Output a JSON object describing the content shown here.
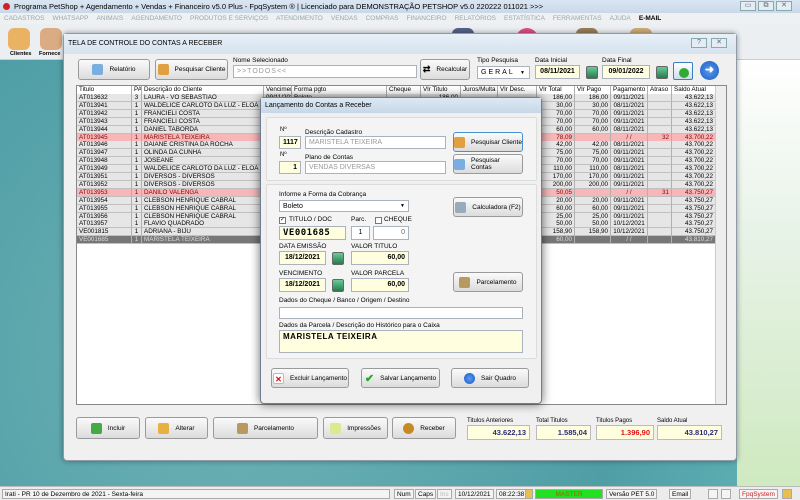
{
  "app": {
    "title": "Programa PetShop + Agendamento + Vendas + Financeiro v5.0 Plus - FpqSystem ® | Licenciado para  DEMONSTRAÇÃO PETSHOP v5.0 220222 011021 >>>",
    "min": "▭",
    "max": "⧉",
    "close": "✕"
  },
  "menu": [
    "CADASTROS",
    "WHATSAPP",
    "ANIMAIS",
    "AGENDAMENTO",
    "PRODUTOS E SERVIÇOS",
    "ATENDIMENTO",
    "VENDAS",
    "COMPRAS",
    "FINANCEIRO",
    "RELATÓRIOS",
    "ESTATÍSTICA",
    "FERRAMENTAS",
    "AJUDA",
    "E-MAIL"
  ],
  "toolbar": {
    "clientes": "Clientes",
    "fornece": "Fornece"
  },
  "main": {
    "title": "TELA DE CONTROLE DO CONTAS A RECEBER",
    "help": "?",
    "close": "✕",
    "relatorio": "Relatório",
    "pesquisar_cliente": "Pesquisar Cliente",
    "nome_label": "Nome Selecionado",
    "nome_value": ">>TODOS<<",
    "recalcular": "Recalcular",
    "tipo_label": "Tipo  Pesquisa",
    "tipo_value": "GERAL",
    "data_inicial_label": "Data Inicial",
    "data_inicial": "08/11/2021",
    "data_final_label": "Data Final",
    "data_final": "09/01/2022"
  },
  "table": {
    "columns": [
      "Titulo",
      "PA",
      "Descrição do Cliente",
      "Vencimento",
      "Forma pgto",
      "Cheque",
      "Vlr Titulo",
      "Juros/Multa",
      "Vlr Desc.",
      "Vlr Total",
      "Vlr Pago",
      "Pagamento",
      "Atraso",
      "Saldo Atual"
    ],
    "rows": [
      {
        "titulo": "AT013632",
        "pa": "3",
        "cliente": "LAURA - VÓ SEBASTIÃO",
        "venc": "09/11/2021",
        "forma": "Boleto",
        "vlr_titulo": "186,00",
        "total": "186,00",
        "pago": "186,00",
        "pagamento": "09/11/2021",
        "atraso": "",
        "saldo": "43.622,13",
        "state": "normal"
      },
      {
        "titulo": "AT013941",
        "pa": "1",
        "cliente": "WALDELICE CARLOTO DA LUZ - ELOÁ",
        "venc": "",
        "forma": "",
        "vlr_titulo": "",
        "total": "30,00",
        "pago": "30,00",
        "pagamento": "08/11/2021",
        "atraso": "",
        "saldo": "43.622,13",
        "state": "normal"
      },
      {
        "titulo": "AT013942",
        "pa": "1",
        "cliente": "FRANCIELI COSTA",
        "venc": "",
        "forma": "",
        "vlr_titulo": "",
        "total": "70,00",
        "pago": "70,00",
        "pagamento": "09/11/2021",
        "atraso": "",
        "saldo": "43.622,13",
        "state": "normal"
      },
      {
        "titulo": "AT013943",
        "pa": "1",
        "cliente": "FRANCIELI COSTA",
        "venc": "",
        "forma": "",
        "vlr_titulo": "",
        "total": "70,00",
        "pago": "70,00",
        "pagamento": "09/11/2021",
        "atraso": "",
        "saldo": "43.622,13",
        "state": "normal"
      },
      {
        "titulo": "AT013944",
        "pa": "1",
        "cliente": "DANIEL TABORDA",
        "venc": "",
        "forma": "",
        "vlr_titulo": "",
        "total": "60,00",
        "pago": "60,00",
        "pagamento": "08/11/2021",
        "atraso": "",
        "saldo": "43.622,13",
        "state": "normal"
      },
      {
        "titulo": "AT013945",
        "pa": "1",
        "cliente": "MARISTELA TEIXEIRA",
        "venc": "",
        "forma": "",
        "vlr_titulo": "",
        "total": "78,09",
        "pago": "",
        "pagamento": "/ /",
        "atraso": "32",
        "saldo": "43.700,22",
        "state": "overdue"
      },
      {
        "titulo": "AT013946",
        "pa": "1",
        "cliente": "DAIANE CRISTINA DA ROCHA",
        "venc": "",
        "forma": "",
        "vlr_titulo": "",
        "total": "42,00",
        "pago": "42,00",
        "pagamento": "08/11/2021",
        "atraso": "",
        "saldo": "43.700,22",
        "state": "normal"
      },
      {
        "titulo": "AT013947",
        "pa": "1",
        "cliente": "OLINDA DA CUNHA",
        "venc": "",
        "forma": "",
        "vlr_titulo": "",
        "total": "75,00",
        "pago": "75,00",
        "pagamento": "09/11/2021",
        "atraso": "",
        "saldo": "43.700,22",
        "state": "normal"
      },
      {
        "titulo": "AT013948",
        "pa": "1",
        "cliente": "JOSEANE",
        "venc": "",
        "forma": "",
        "vlr_titulo": "",
        "total": "70,00",
        "pago": "70,00",
        "pagamento": "09/11/2021",
        "atraso": "",
        "saldo": "43.700,22",
        "state": "normal"
      },
      {
        "titulo": "AT013949",
        "pa": "1",
        "cliente": "WALDELICE CARLOTO DA LUZ - ELOÁ",
        "venc": "",
        "forma": "",
        "vlr_titulo": "",
        "total": "110,00",
        "pago": "110,00",
        "pagamento": "08/11/2021",
        "atraso": "",
        "saldo": "43.700,22",
        "state": "normal"
      },
      {
        "titulo": "AT013951",
        "pa": "1",
        "cliente": "DIVERSOS - DIVERSOS",
        "venc": "",
        "forma": "",
        "vlr_titulo": "",
        "total": "170,00",
        "pago": "170,00",
        "pagamento": "09/11/2021",
        "atraso": "",
        "saldo": "43.700,22",
        "state": "normal"
      },
      {
        "titulo": "AT013952",
        "pa": "1",
        "cliente": "DIVERSOS - DIVERSOS",
        "venc": "",
        "forma": "",
        "vlr_titulo": "",
        "total": "200,00",
        "pago": "200,00",
        "pagamento": "09/11/2021",
        "atraso": "",
        "saldo": "43.700,22",
        "state": "normal"
      },
      {
        "titulo": "AT013953",
        "pa": "1",
        "cliente": "DANILO VALENGA",
        "venc": "",
        "forma": "",
        "vlr_titulo": "",
        "total": "50,05",
        "pago": "",
        "pagamento": "/ /",
        "atraso": "31",
        "saldo": "43.750,27",
        "state": "overdue"
      },
      {
        "titulo": "AT013954",
        "pa": "1",
        "cliente": "CLEBSON HENRIQUE CABRAL",
        "venc": "",
        "forma": "",
        "vlr_titulo": "",
        "total": "20,00",
        "pago": "20,00",
        "pagamento": "09/11/2021",
        "atraso": "",
        "saldo": "43.750,27",
        "state": "normal"
      },
      {
        "titulo": "AT013955",
        "pa": "1",
        "cliente": "CLEBSON HENRIQUE CABRAL",
        "venc": "",
        "forma": "",
        "vlr_titulo": "",
        "total": "60,00",
        "pago": "60,00",
        "pagamento": "09/11/2021",
        "atraso": "",
        "saldo": "43.750,27",
        "state": "normal"
      },
      {
        "titulo": "AT013956",
        "pa": "1",
        "cliente": "CLEBSON HENRIQUE CABRAL",
        "venc": "",
        "forma": "",
        "vlr_titulo": "",
        "total": "25,00",
        "pago": "25,00",
        "pagamento": "09/11/2021",
        "atraso": "",
        "saldo": "43.750,27",
        "state": "normal"
      },
      {
        "titulo": "AT013957",
        "pa": "1",
        "cliente": "FLAVIO QUADRADO",
        "venc": "",
        "forma": "",
        "vlr_titulo": "",
        "total": "50,00",
        "pago": "50,00",
        "pagamento": "10/12/2021",
        "atraso": "",
        "saldo": "43.750,27",
        "state": "normal"
      },
      {
        "titulo": "VE001815",
        "pa": "1",
        "cliente": "ADRIANA  - BIJU",
        "venc": "",
        "forma": "",
        "vlr_titulo": "",
        "total": "158,90",
        "pago": "158,90",
        "pagamento": "10/12/2021",
        "atraso": "",
        "saldo": "43.750,27",
        "state": "normal"
      },
      {
        "titulo": "VE001685",
        "pa": "1",
        "cliente": "MARISTELA TEIXEIRA",
        "venc": "",
        "forma": "",
        "vlr_titulo": "",
        "total": "60,00",
        "pago": "",
        "pagamento": "/ /",
        "atraso": "",
        "saldo": "43.810,27",
        "state": "selected"
      }
    ]
  },
  "dialog": {
    "title": "Lançamento do Contas a Receber",
    "no_label": "Nº",
    "cadastro_label": "Descrição Cadastro",
    "cadastro_no": "1117",
    "cadastro_nome": "MARISTELA TEIXEIRA",
    "no2_label": "Nº",
    "plano_label": "Plano de Contas",
    "plano_no": "1",
    "plano_nome": "VENDAS DIVERSAS",
    "pesquisar_cliente": "Pesquisar Cliente",
    "pesquisar_contas": "Pesquisar Contas",
    "forma_label": "Informe a Forma da Cobrança",
    "forma_value": "Boleto",
    "calculadora": "Calculadora (F2)",
    "titulo_doc_label": "TITULO / DOC",
    "titulo_doc_checked": true,
    "parc_label": "Parc.",
    "cheque_label": "CHEQUE",
    "cheque_checked": false,
    "titulo_doc": "VE001685",
    "parc": "1",
    "cheque": "0",
    "emissao_label": "DATA EMISSÃO",
    "emissao": "18/12/2021",
    "valor_titulo_label": "VALOR TITULO",
    "valor_titulo": "60,00",
    "venc_label": "VENCIMENTO",
    "venc": "18/12/2021",
    "valor_parcela_label": "VALOR PARCELA",
    "valor_parcela": "60,00",
    "parcelamento": "Parcelamento",
    "dados_cheque_label": "Dados do Cheque / Banco / Origem / Destino",
    "dados_cheque": "",
    "dados_parcela_label": "Dados da Parcela / Descrição do Histórico para o Caixa",
    "dados_parcela": "MARISTELA TEIXEIRA",
    "excluir": "Excluir Lançamento",
    "salvar": "Salvar Lançamento",
    "sair": "Sair Quadro"
  },
  "bottom": {
    "incluir": "Incluir",
    "alterar": "Alterar",
    "parcelamento": "Parcelamento",
    "impressoes": "Impressões",
    "receber": "Receber",
    "anteriores_label": "Titulos Anteriores",
    "anteriores": "43.622,13",
    "total_label": "Total Titulos",
    "total": "1.585,04",
    "pagos_label": "Titulos Pagos",
    "pagos": "1.396,90",
    "saldo_label": "Saldo Atual",
    "saldo": "43.810,27"
  },
  "status": {
    "location": "Irati - PR 10 de Dezembro de 2021 - Sexta-feira",
    "num": "Num",
    "caps": "Caps",
    "ins": "Ins",
    "date": "10/12/2021",
    "time": "08:22:38",
    "user": "MASTER",
    "versao": "Versão PET 5.0",
    "email": "Email",
    "brand": "FpqSystem"
  },
  "colors": {
    "overdue_row": "#f7b7b9",
    "selected_row": "#777777",
    "master_green": "#22e022",
    "pagos_red": "#e01010",
    "totals_blue": "#2a2a7a"
  }
}
